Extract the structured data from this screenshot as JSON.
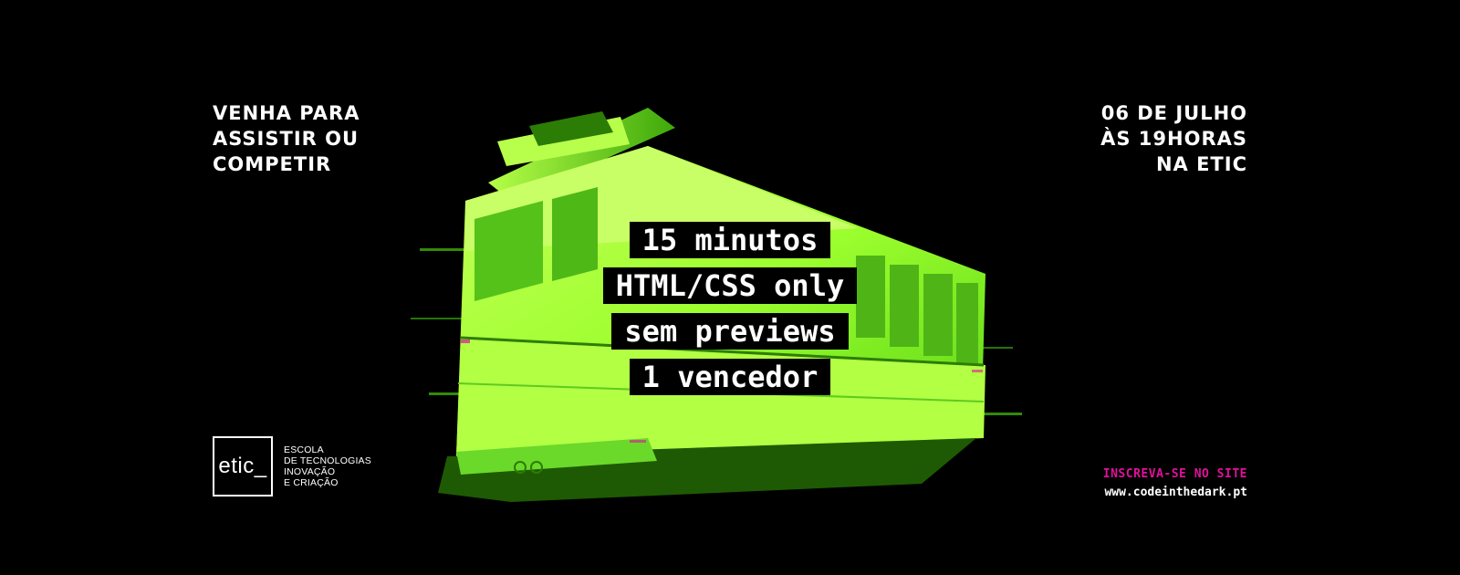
{
  "tagline": {
    "lines": [
      "VENHA PARA",
      "ASSISTIR OU",
      "COMPETIR"
    ]
  },
  "event": {
    "lines": [
      "06 DE JULHO",
      "ÀS 19HORAS",
      "NA ETIC"
    ]
  },
  "rules": [
    "15 minutos",
    "HTML/CSS only",
    "sem previews",
    "1 vencedor"
  ],
  "logo": {
    "mark": "etic_",
    "lines": [
      "ESCOLA",
      "DE TECNOLOGIAS",
      "INOVAÇÃO",
      "E CRIAÇÃO"
    ]
  },
  "cta": {
    "title": "INSCREVA-SE NO SITE",
    "url": "www.codeinthedark.pt"
  },
  "colors": {
    "background": "#000000",
    "tram_green": "#9dff2e",
    "cta_pink": "#e0119a"
  }
}
